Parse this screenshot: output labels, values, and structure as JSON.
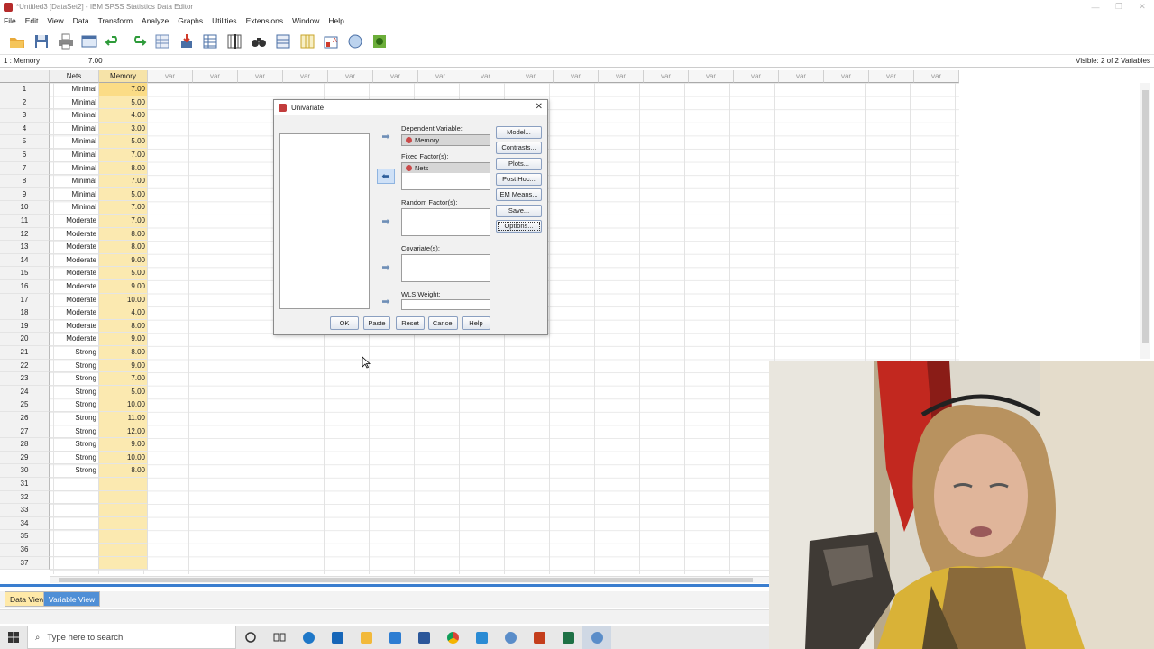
{
  "window": {
    "title": "*Untitled3 [DataSet2] - IBM SPSS Statistics Data Editor",
    "controls": [
      "—",
      "❐",
      "✕"
    ]
  },
  "menu": [
    "File",
    "Edit",
    "View",
    "Data",
    "Transform",
    "Analyze",
    "Graphs",
    "Utilities",
    "Extensions",
    "Window",
    "Help"
  ],
  "toolbar": {
    "icons": [
      "open-folder-icon",
      "save-icon",
      "print-icon",
      "recall-dialog-icon",
      "undo-icon",
      "redo-icon",
      "goto-case-icon",
      "goto-variable-icon",
      "variables-icon",
      "run-descriptives-icon",
      "find-icon",
      "insert-cases-icon",
      "insert-variable-icon",
      "split-file-icon",
      "weight-cases-icon",
      "select-cases-icon",
      "value-labels-icon",
      "use-sets-icon"
    ]
  },
  "cellbar": {
    "ref": "1 : Memory",
    "value": "7.00",
    "visible": "Visible: 2 of 2 Variables"
  },
  "columns": [
    "Nets",
    "Memory",
    "var",
    "var",
    "var",
    "var",
    "var",
    "var",
    "var",
    "var",
    "var",
    "var",
    "var",
    "var",
    "var",
    "var",
    "var",
    "var",
    "var"
  ],
  "rows": [
    [
      "1",
      "Minimal",
      "7.00"
    ],
    [
      "2",
      "Minimal",
      "5.00"
    ],
    [
      "3",
      "Minimal",
      "4.00"
    ],
    [
      "4",
      "Minimal",
      "3.00"
    ],
    [
      "5",
      "Minimal",
      "5.00"
    ],
    [
      "6",
      "Minimal",
      "7.00"
    ],
    [
      "7",
      "Minimal",
      "8.00"
    ],
    [
      "8",
      "Minimal",
      "7.00"
    ],
    [
      "9",
      "Minimal",
      "5.00"
    ],
    [
      "10",
      "Minimal",
      "7.00"
    ],
    [
      "11",
      "Moderate",
      "7.00"
    ],
    [
      "12",
      "Moderate",
      "8.00"
    ],
    [
      "13",
      "Moderate",
      "8.00"
    ],
    [
      "14",
      "Moderate",
      "9.00"
    ],
    [
      "15",
      "Moderate",
      "5.00"
    ],
    [
      "16",
      "Moderate",
      "9.00"
    ],
    [
      "17",
      "Moderate",
      "10.00"
    ],
    [
      "18",
      "Moderate",
      "4.00"
    ],
    [
      "19",
      "Moderate",
      "8.00"
    ],
    [
      "20",
      "Moderate",
      "9.00"
    ],
    [
      "21",
      "Strong",
      "8.00"
    ],
    [
      "22",
      "Strong",
      "9.00"
    ],
    [
      "23",
      "Strong",
      "7.00"
    ],
    [
      "24",
      "Strong",
      "5.00"
    ],
    [
      "25",
      "Strong",
      "10.00"
    ],
    [
      "26",
      "Strong",
      "11.00"
    ],
    [
      "27",
      "Strong",
      "12.00"
    ],
    [
      "28",
      "Strong",
      "9.00"
    ],
    [
      "29",
      "Strong",
      "10.00"
    ],
    [
      "30",
      "Strong",
      "8.00"
    ],
    [
      "31",
      "",
      ""
    ],
    [
      "32",
      "",
      ""
    ],
    [
      "33",
      "",
      ""
    ],
    [
      "34",
      "",
      ""
    ],
    [
      "35",
      "",
      ""
    ],
    [
      "36",
      "",
      ""
    ],
    [
      "37",
      "",
      ""
    ]
  ],
  "tabs": {
    "data_view": "Data View",
    "variable_view": "Variable View"
  },
  "dialog": {
    "title": "Univariate",
    "dependent_label": "Dependent Variable:",
    "dependent_value": "Memory",
    "fixed_label": "Fixed Factor(s):",
    "fixed_value": "Nets",
    "random_label": "Random Factor(s):",
    "covariate_label": "Covariate(s):",
    "wls_label": "WLS Weight:",
    "side_buttons": [
      "Model...",
      "Contrasts...",
      "Plots...",
      "Post Hoc...",
      "EM Means...",
      "Save...",
      "Options..."
    ],
    "ok": "OK",
    "paste": "Paste",
    "reset": "Reset",
    "cancel": "Cancel",
    "help": "Help"
  },
  "taskbar": {
    "search_placeholder": "Type here to search"
  },
  "colors": {
    "memory_column": "#fbe9b0",
    "active_tab": "#ffe9a8",
    "inactive_tab": "#4f8fd6",
    "accent_blue": "#3a7ecf"
  }
}
